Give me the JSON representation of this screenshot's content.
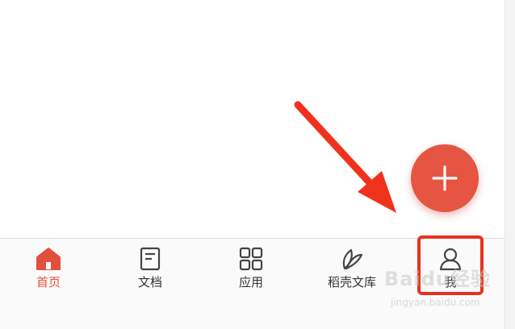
{
  "tab_bar": {
    "tabs": [
      {
        "id": "home",
        "label": "首页",
        "icon": "home-icon",
        "active": true
      },
      {
        "id": "docs",
        "label": "文档",
        "icon": "document-icon",
        "active": false
      },
      {
        "id": "apps",
        "label": "应用",
        "icon": "apps-grid-icon",
        "active": false
      },
      {
        "id": "library",
        "label": "稻壳文库",
        "icon": "leaf-icon",
        "active": false
      },
      {
        "id": "me",
        "label": "我",
        "icon": "user-icon",
        "active": false
      }
    ]
  },
  "fab": {
    "icon": "plus-icon"
  },
  "annotation": {
    "arrow_color": "#f0321c",
    "box_color": "#e8321e"
  },
  "watermark": {
    "logo_text": "Baidu经验",
    "url": "jingyan.baidu.com"
  },
  "colors": {
    "accent": "#e65541",
    "active_tab": "#e0503c",
    "inactive_icon": "#444444"
  }
}
